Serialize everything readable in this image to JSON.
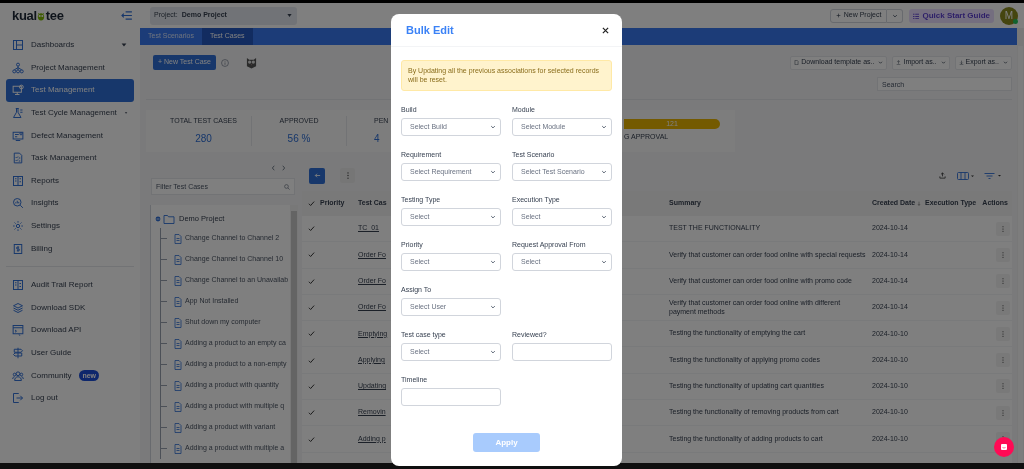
{
  "sidebar": {
    "logo_start": "kual",
    "logo_end": "tee",
    "groups": [
      {
        "items": [
          {
            "label": "Dashboards",
            "has_menu": true,
            "selected": false
          },
          {
            "label": "Project Management",
            "has_menu": false,
            "selected": false
          },
          {
            "label": "Test Management",
            "has_menu": false,
            "selected": true
          },
          {
            "label": "Test Cycle Management",
            "has_menu": true,
            "selected": false
          },
          {
            "label": "Defect Management",
            "has_menu": false,
            "selected": false
          },
          {
            "label": "Task Management",
            "has_menu": false,
            "selected": false
          },
          {
            "label": "Reports",
            "has_menu": false,
            "selected": false
          },
          {
            "label": "Insights",
            "has_menu": false,
            "selected": false
          },
          {
            "label": "Settings",
            "has_menu": false,
            "selected": false
          },
          {
            "label": "Billing",
            "has_menu": false,
            "selected": false
          }
        ]
      },
      {
        "items": [
          {
            "label": "Audit Trail Report",
            "has_menu": false,
            "selected": false
          },
          {
            "label": "Download SDK",
            "has_menu": false,
            "selected": false
          },
          {
            "label": "Download API",
            "has_menu": false,
            "selected": false
          },
          {
            "label": "User Guide",
            "has_menu": false,
            "selected": false
          },
          {
            "label": "Community",
            "has_menu": false,
            "selected": false,
            "badge": "new"
          },
          {
            "label": "Log out",
            "has_menu": false,
            "selected": false
          }
        ]
      }
    ]
  },
  "header": {
    "project_label": "Project:",
    "project_value": "Demo Project",
    "new_project": "New Project",
    "quick_start": "Quick Start Guide",
    "avatar": "M"
  },
  "tabs": [
    {
      "label": "Test Scenarios",
      "selected": false
    },
    {
      "label": "Test Cases",
      "selected": true
    }
  ],
  "toolbar": {
    "new_test_case": "+ New Test Case",
    "buttons": [
      "Download template as..",
      "Import as..",
      "Export as.."
    ],
    "search_placeholder": "Search"
  },
  "stats": [
    {
      "label": "TOTAL TEST CASES",
      "value": "280"
    },
    {
      "label": "APPROVED",
      "value": "56 %"
    },
    {
      "label": "PEN",
      "value": "4"
    }
  ],
  "pending": {
    "value": "121",
    "label": "G APPROVAL"
  },
  "tree": {
    "filter_placeholder": "Filter Test Cases",
    "root": {
      "label": "Demo Project",
      "expanded": true,
      "children": [
        {
          "label": "Change Channel to Channel 2"
        },
        {
          "label": "Change Channel to Channel 10"
        },
        {
          "label": "Change Channel to an Unavailab"
        },
        {
          "label": "App Not Installed"
        },
        {
          "label": "Shut down my computer"
        },
        {
          "label": "Adding a product to an empty ca"
        },
        {
          "label": "Adding a product to a non-empty"
        },
        {
          "label": "Adding a product with quantity"
        },
        {
          "label": "Adding a product with multiple q"
        },
        {
          "label": "Adding a product with variant"
        },
        {
          "label": "Adding a product with multiple a"
        }
      ]
    }
  },
  "table": {
    "all_checked": true,
    "columns": {
      "priority": "Priority",
      "test_case": "Test Cas",
      "summary": "Summary",
      "created": "Created Date",
      "execution": "Execution Type",
      "actions": "Actions"
    },
    "rows": [
      {
        "checked": true,
        "test_case": "TC_01",
        "summary": "TEST THE FUNCTIONALITY",
        "created": "2024-10-14"
      },
      {
        "checked": true,
        "test_case": "Order Fo",
        "summary": "Verify that customer can order food online with special requests",
        "created": "2024-10-14"
      },
      {
        "checked": true,
        "test_case": "Order Fo",
        "summary": "Verify that customer can order food online with promo code",
        "created": "2024-10-14"
      },
      {
        "checked": true,
        "test_case": "Order Fo",
        "summary": "Verify that customer can order food online with different payment methods",
        "created": "2024-10-14"
      },
      {
        "checked": true,
        "test_case": "Emptying",
        "summary": "Testing the functionality of emptying the cart",
        "created": "2024-10-10"
      },
      {
        "checked": true,
        "test_case": "Applying",
        "summary": "Testing the functionality of applying promo codes",
        "created": "2024-10-10"
      },
      {
        "checked": true,
        "test_case": "Updating",
        "summary": "Testing the functionality of updating cart quantities",
        "created": "2024-10-10"
      },
      {
        "checked": true,
        "test_case": "Removin",
        "summary": "Testing the functionality of removing products from cart",
        "created": "2024-10-10"
      },
      {
        "checked": true,
        "test_case": "Adding p",
        "summary": "Testing the functionality of adding products to cart",
        "created": "2024-10-10"
      }
    ]
  },
  "modal": {
    "title": "Bulk Edit",
    "notice": "By Updating all the previous associations for selected records will be reset.",
    "rows": [
      {
        "fields": [
          {
            "label": "Build",
            "kind": "select",
            "placeholder": "Select Build"
          },
          {
            "label": "Module",
            "kind": "select",
            "placeholder": "Select Module"
          }
        ]
      },
      {
        "fields": [
          {
            "label": "Requirement",
            "kind": "select",
            "placeholder": "Select Requirement"
          },
          {
            "label": "Test Scenario",
            "kind": "select",
            "placeholder": "Select Test Scenario"
          }
        ]
      },
      {
        "fields": [
          {
            "label": "Testing Type",
            "kind": "select",
            "placeholder": "Select"
          },
          {
            "label": "Execution Type",
            "kind": "select",
            "placeholder": "Select"
          }
        ]
      },
      {
        "fields": [
          {
            "label": "Priority",
            "kind": "select",
            "placeholder": "Select"
          },
          {
            "label": "Request Approval From",
            "kind": "select",
            "placeholder": "Select"
          }
        ]
      },
      {
        "fields": [
          {
            "label": "Assign To",
            "kind": "select",
            "placeholder": "Select User"
          }
        ]
      },
      {
        "fields": [
          {
            "label": "Test case type",
            "kind": "select",
            "placeholder": "Select"
          },
          {
            "label": "Reviewed?",
            "kind": "input"
          }
        ]
      },
      {
        "fields": [
          {
            "label": "Timeline",
            "kind": "input"
          }
        ]
      }
    ],
    "apply": {
      "label": "Apply",
      "disabled": true
    }
  }
}
